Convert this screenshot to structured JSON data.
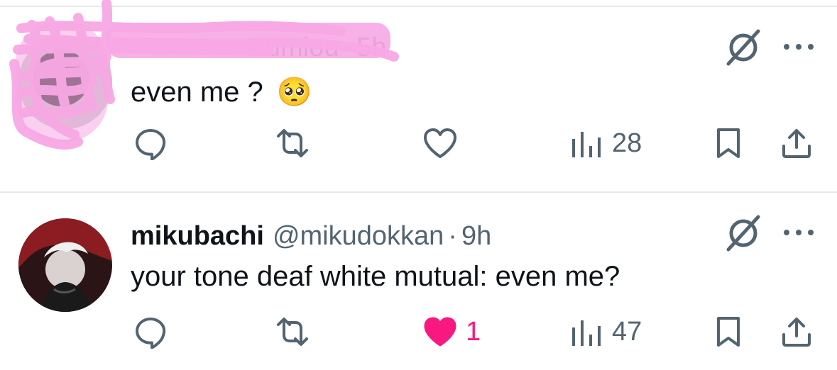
{
  "tweets": [
    {
      "name": "",
      "handle": "",
      "handle_fragment": "umiou",
      "separator": "·",
      "time": "5h",
      "text": "even me ?",
      "emoji": "🥺",
      "metrics": {
        "replies": "",
        "reposts": "",
        "likes": "",
        "views": "28"
      },
      "liked": false
    },
    {
      "name": "mikubachi",
      "handle": "@mikudokkan",
      "separator": "·",
      "time": "9h",
      "text": "your tone deaf white mutual: even me?",
      "metrics": {
        "replies": "",
        "reposts": "",
        "likes": "1",
        "views": "47"
      },
      "liked": true
    }
  ],
  "icons": {
    "reply": "reply-icon",
    "repost": "repost-icon",
    "like": "heart-icon",
    "views": "views-icon",
    "bookmark": "bookmark-icon",
    "share": "share-icon",
    "grok": "grok-icon",
    "more": "more-icon"
  },
  "colors": {
    "text": "#0f1419",
    "secondary": "#536471",
    "like_pink": "#f91880",
    "divider": "#e6e9ec",
    "redaction": "#f7a8e4"
  }
}
